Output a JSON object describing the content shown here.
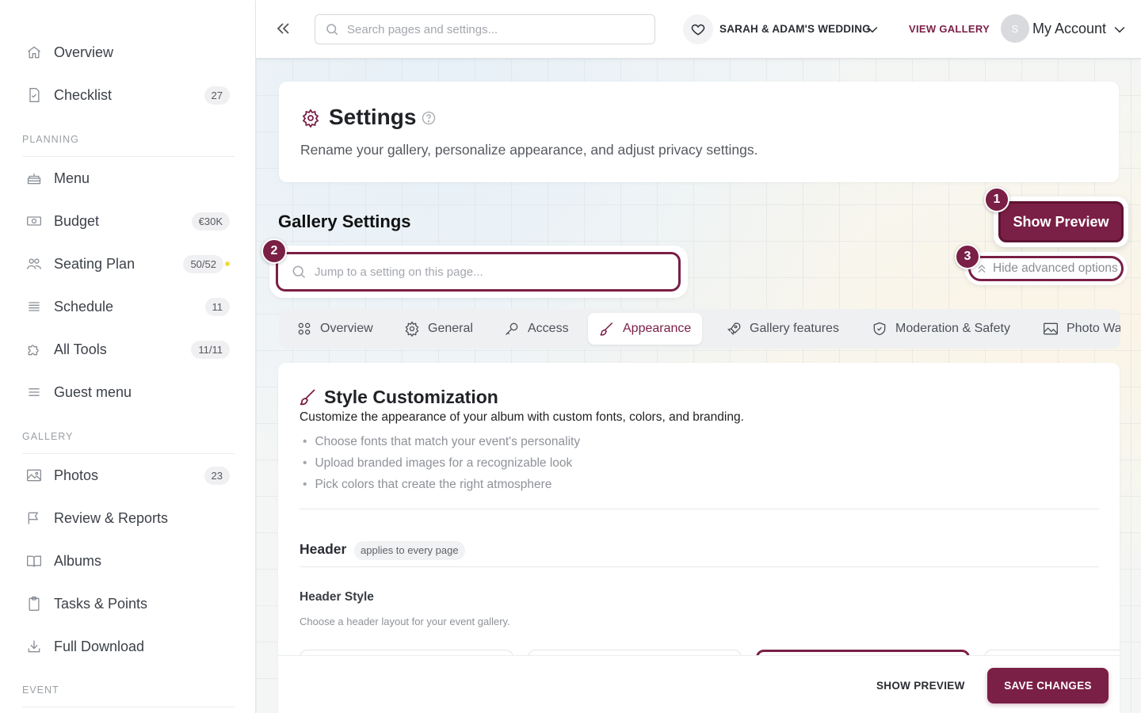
{
  "sidebar": {
    "items": [
      {
        "label": "Overview",
        "icon": "home-icon"
      },
      {
        "label": "Checklist",
        "icon": "checklist-icon",
        "count": "27"
      },
      {
        "label": "Menu",
        "icon": "cake-icon"
      },
      {
        "label": "Budget",
        "icon": "money-icon",
        "count": "€30K"
      },
      {
        "label": "Seating Plan",
        "icon": "people-icon",
        "count": "50/52"
      },
      {
        "label": "Schedule",
        "icon": "list-icon",
        "count": "11"
      },
      {
        "label": "All Tools",
        "icon": "puzzle-icon",
        "count": "11/11"
      },
      {
        "label": "Guest menu",
        "icon": "menu-icon"
      },
      {
        "label": "Photos",
        "icon": "image-icon",
        "count": "23"
      },
      {
        "label": "Review & Reports",
        "icon": "flag-icon"
      },
      {
        "label": "Albums",
        "icon": "book-icon"
      },
      {
        "label": "Tasks & Points",
        "icon": "clipboard-icon"
      },
      {
        "label": "Full Download",
        "icon": "download-icon"
      }
    ],
    "sections": {
      "planning": "PLANNING",
      "gallery": "GALLERY",
      "event": "EVENT"
    },
    "status_dot_color": "#f2dc3c"
  },
  "topbar": {
    "search_placeholder": "Search pages and settings...",
    "event_name": "SARAH & ADAM'S WEDDING",
    "view_gallery": "VIEW GALLERY",
    "avatar_initial": "S",
    "account_label": "My Account"
  },
  "page": {
    "title": "Settings",
    "subtitle": "Rename your gallery, personalize appearance, and adjust privacy settings.",
    "gallery_settings_title": "Gallery Settings",
    "jump_placeholder": "Jump to a setting on this page...",
    "show_preview": "Show Preview",
    "hide_advanced": "Hide advanced options",
    "badges": [
      "1",
      "2",
      "3"
    ]
  },
  "tabs": [
    {
      "label": "Overview",
      "icon": "grid-icon"
    },
    {
      "label": "General",
      "icon": "gear-icon"
    },
    {
      "label": "Access",
      "icon": "key-icon"
    },
    {
      "label": "Appearance",
      "icon": "brush-icon",
      "active": true
    },
    {
      "label": "Gallery features",
      "icon": "rocket-icon"
    },
    {
      "label": "Moderation & Safety",
      "icon": "shield-icon"
    },
    {
      "label": "Photo Wa",
      "icon": "image-icon"
    }
  ],
  "style_section": {
    "title": "Style Customization",
    "description": "Customize the appearance of your album with custom fonts, colors, and branding.",
    "bullets": [
      "Choose fonts that match your event's personality",
      "Upload branded images for a recognizable look",
      "Pick colors that create the right atmosphere"
    ],
    "header_title": "Header",
    "header_pill": "applies to every page",
    "header_style_title": "Header Style",
    "header_style_desc": "Choose a header layout for your event gallery."
  },
  "actions": {
    "show_preview": "SHOW PREVIEW",
    "save_changes": "SAVE CHANGES"
  },
  "colors": {
    "brand": "#7a1f45"
  }
}
